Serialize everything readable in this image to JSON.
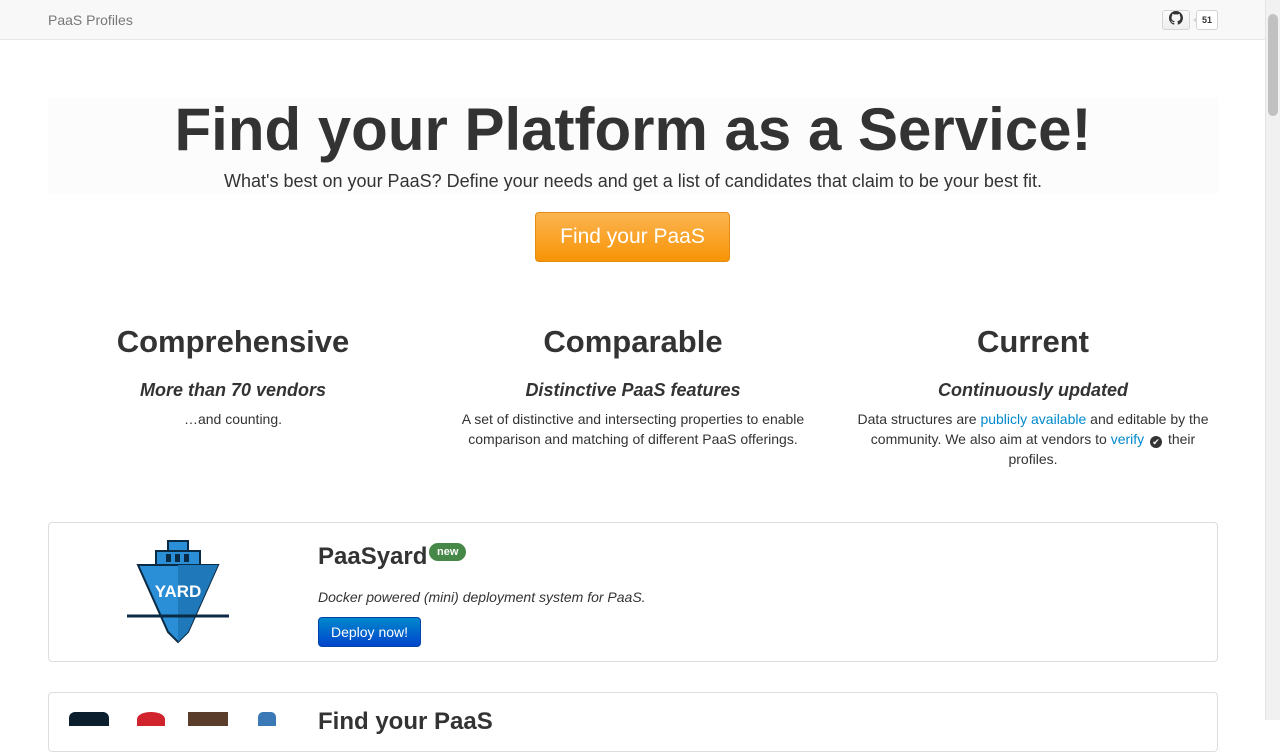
{
  "navbar": {
    "brand": "PaaS Profiles",
    "github_star_count": "51"
  },
  "hero": {
    "title": "Find your Platform as a Service!",
    "subtitle": "What's best on your PaaS? Define your needs and get a list of candidates that claim to be your best fit.",
    "button_label": "Find your PaaS"
  },
  "features": [
    {
      "heading": "Comprehensive",
      "tagline": "More than 70 vendors",
      "text": "…and counting."
    },
    {
      "heading": "Comparable",
      "tagline": "Distinctive PaaS features",
      "text": "A set of distinctive and intersecting properties to enable comparison and matching of different PaaS offerings."
    },
    {
      "heading": "Current",
      "tagline": "Continuously updated",
      "text_before_link": "Data structures are ",
      "link1": "publicly available",
      "text_middle": " and editable by the community. We also aim at vendors to ",
      "link2": "verify",
      "text_after": " their profiles."
    }
  ],
  "promo": {
    "logo_text": "YARD",
    "title": "PaaSyard",
    "badge": "new",
    "description": "Docker powered (mini) deployment system for PaaS.",
    "button_label": "Deploy now!"
  },
  "next_card": {
    "title": "Find your PaaS"
  },
  "icons": {
    "github": "github-icon",
    "verify": "check-circle-icon",
    "logo": "ship-yard-logo"
  },
  "colors": {
    "hero_button": "#f89406",
    "deploy_button": "#0055cc",
    "badge_new": "#468847",
    "link": "#0088cc",
    "logo_blue": "#2a8fd6"
  }
}
